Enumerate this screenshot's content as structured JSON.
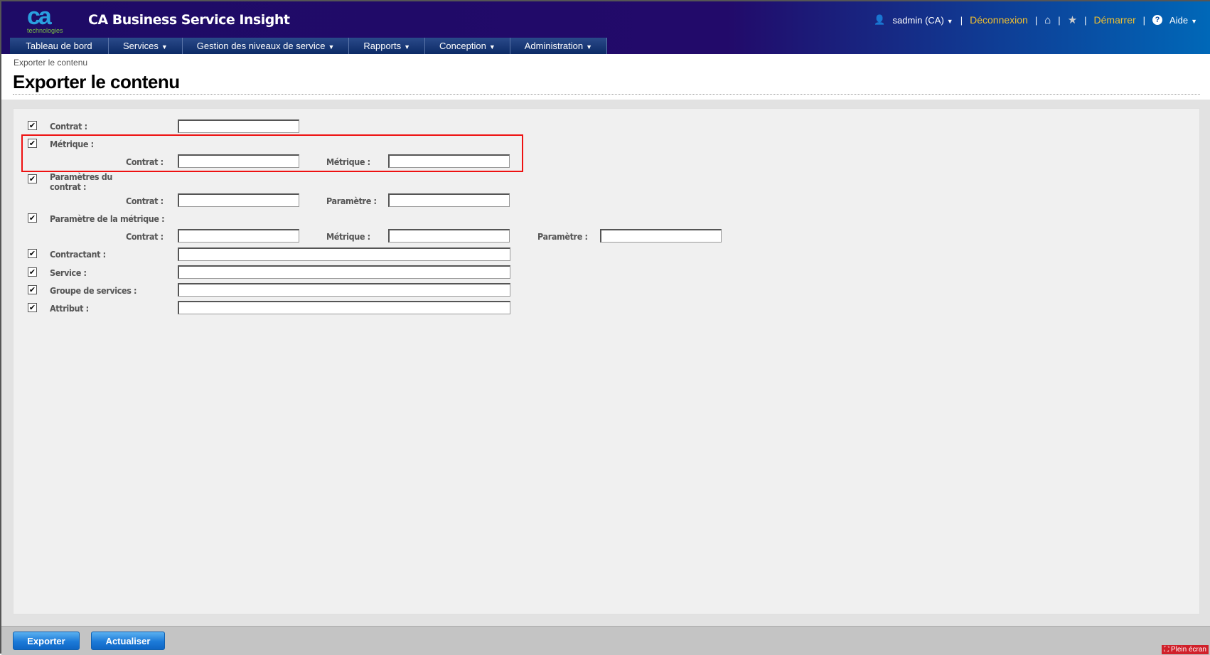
{
  "header": {
    "logo_text": "ca",
    "logo_sub": "technologies",
    "app_title": "CA Business Service Insight",
    "user": "sadmin (CA)",
    "logout": "Déconnexion",
    "start": "Démarrer",
    "help": "Aide"
  },
  "nav": [
    "Tableau de bord",
    "Services",
    "Gestion des niveaux de service",
    "Rapports",
    "Conception",
    "Administration"
  ],
  "breadcrumb": "Exporter le contenu",
  "page_title": "Exporter le contenu",
  "form": {
    "contrat": "Contrat :",
    "metrique": "Métrique :",
    "param_contrat": "Paramètres du contrat :",
    "param_metrique": "Paramètre de la métrique :",
    "contractant": "Contractant :",
    "service": "Service :",
    "groupe": "Groupe de services :",
    "attribut": "Attribut :",
    "sub_contrat": "Contrat :",
    "sub_metrique": "Métrique :",
    "sub_parametre": "Paramètre :"
  },
  "buttons": {
    "export": "Exporter",
    "refresh": "Actualiser"
  },
  "fullscreen": "Plein écran",
  "colors": {
    "highlight": "#ee1111",
    "button": "#1c7ad8"
  }
}
